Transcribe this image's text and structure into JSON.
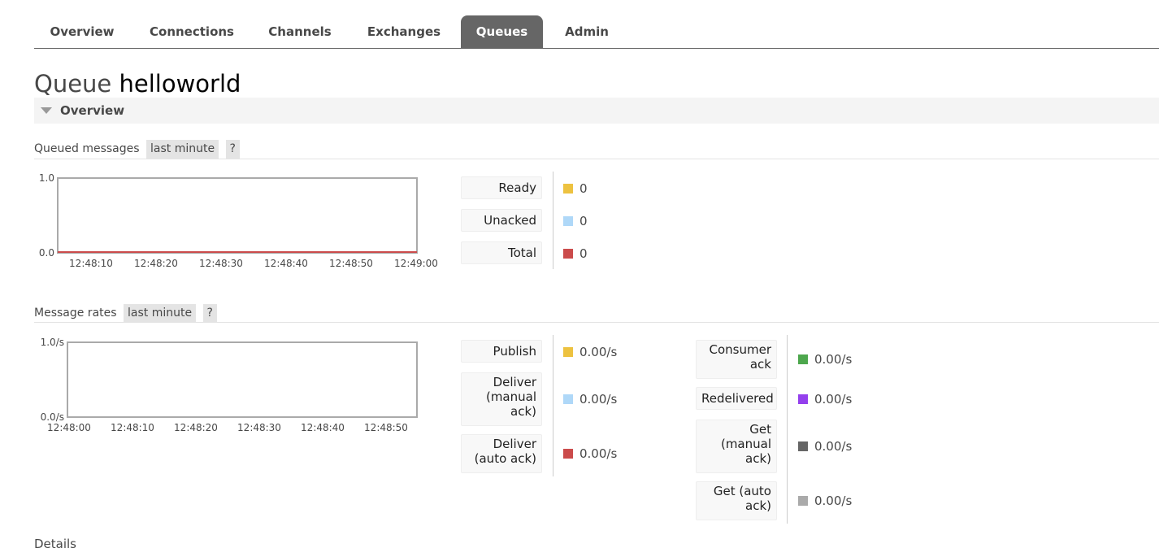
{
  "nav": {
    "tabs": [
      {
        "label": "Overview",
        "active": false
      },
      {
        "label": "Connections",
        "active": false
      },
      {
        "label": "Channels",
        "active": false
      },
      {
        "label": "Exchanges",
        "active": false
      },
      {
        "label": "Queues",
        "active": true
      },
      {
        "label": "Admin",
        "active": false
      }
    ]
  },
  "page": {
    "title_prefix": "Queue",
    "queue_name": "helloworld",
    "section_title": "Overview",
    "details_label": "Details"
  },
  "queued": {
    "heading": "Queued messages",
    "range": "last minute",
    "help": "?",
    "legend": [
      {
        "label": "Ready",
        "value": "0",
        "color": "#edc240"
      },
      {
        "label": "Unacked",
        "value": "0",
        "color": "#afd8f8"
      },
      {
        "label": "Total",
        "value": "0",
        "color": "#cb4b4b"
      }
    ]
  },
  "rates": {
    "heading": "Message rates",
    "range": "last minute",
    "help": "?",
    "legend_left": [
      {
        "label": "Publish",
        "value": "0.00/s",
        "color": "#edc240"
      },
      {
        "label": "Deliver (manual ack)",
        "value": "0.00/s",
        "color": "#afd8f8"
      },
      {
        "label": "Deliver (auto ack)",
        "value": "0.00/s",
        "color": "#cb4b4b"
      }
    ],
    "legend_right": [
      {
        "label": "Consumer ack",
        "value": "0.00/s",
        "color": "#4da74d"
      },
      {
        "label": "Redelivered",
        "value": "0.00/s",
        "color": "#9440ed"
      },
      {
        "label": "Get (manual ack)",
        "value": "0.00/s",
        "color": "#666666"
      },
      {
        "label": "Get (auto ack)",
        "value": "0.00/s",
        "color": "#aaaaaa"
      }
    ]
  },
  "chart_data": [
    {
      "type": "line",
      "x": [
        "12:48:10",
        "12:48:20",
        "12:48:30",
        "12:48:40",
        "12:48:50",
        "12:49:00"
      ],
      "yticks": [
        "1.0",
        "0.0"
      ],
      "ylim": [
        0,
        1
      ],
      "series": [
        {
          "name": "Ready",
          "values": [
            0,
            0,
            0,
            0,
            0,
            0
          ],
          "color": "#edc240"
        },
        {
          "name": "Unacked",
          "values": [
            0,
            0,
            0,
            0,
            0,
            0
          ],
          "color": "#afd8f8"
        },
        {
          "name": "Total",
          "values": [
            0,
            0,
            0,
            0,
            0,
            0
          ],
          "color": "#cb4b4b"
        }
      ],
      "grid": false
    },
    {
      "type": "line",
      "x": [
        "12:48:00",
        "12:48:10",
        "12:48:20",
        "12:48:30",
        "12:48:40",
        "12:48:50"
      ],
      "yticks": [
        "1.0/s",
        "0.0/s"
      ],
      "ylim": [
        0,
        1
      ],
      "series": [],
      "grid": false
    }
  ]
}
